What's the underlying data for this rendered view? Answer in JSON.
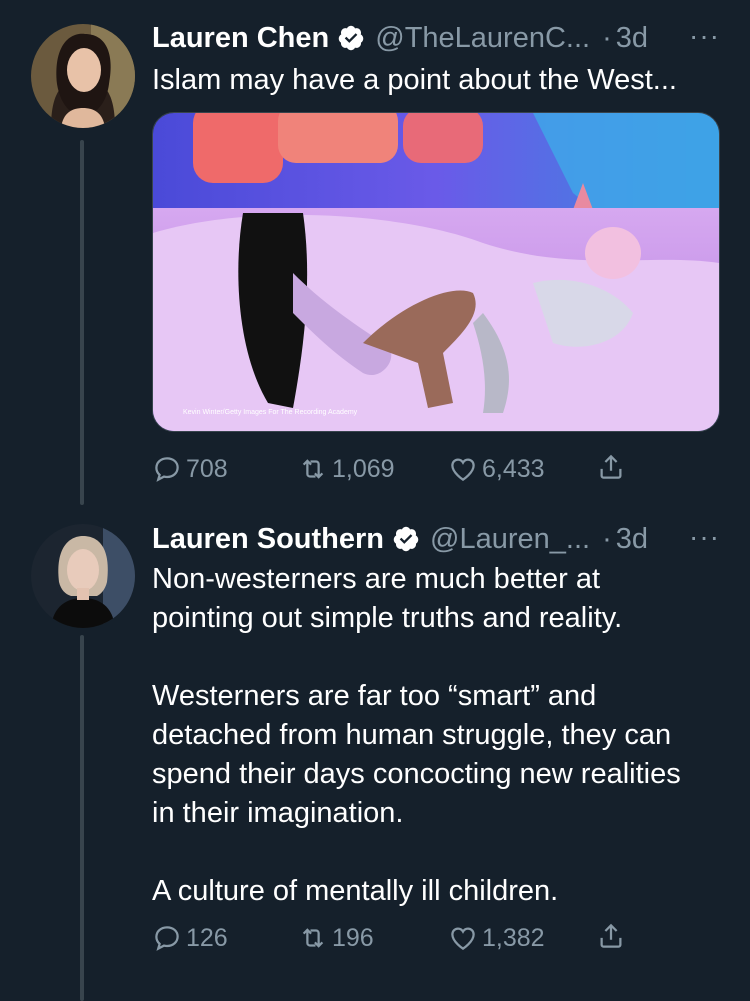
{
  "tweets": [
    {
      "name": "Lauren Chen",
      "handle": "@TheLaurenC...",
      "dot": "·",
      "time": "3d",
      "more": "···",
      "text": "Islam may have a point about the West...",
      "media_credit": "Kevin Winter/Getty Images For The Recording Academy",
      "replies": "708",
      "retweets": "1,069",
      "likes": "6,433"
    },
    {
      "name": "Lauren Southern",
      "handle": "@Lauren_...",
      "dot": "·",
      "time": "3d",
      "more": "···",
      "text": "Non-westerners are much better at\npointing out simple truths and reality.\n\nWesterners are far too “smart” and\ndetached from human struggle, they can\nspend their days concocting new realities\nin their imagination.\n\nA culture of mentally ill children.",
      "replies": "126",
      "retweets": "196",
      "likes": "1,382"
    }
  ],
  "colors": {
    "background": "#15202b",
    "secondary_text": "#8899a6",
    "verified": "#ffffff",
    "line": "#38444d"
  },
  "icons": [
    "reply-icon",
    "retweet-icon",
    "like-icon",
    "share-icon",
    "verified-icon",
    "more-icon"
  ]
}
